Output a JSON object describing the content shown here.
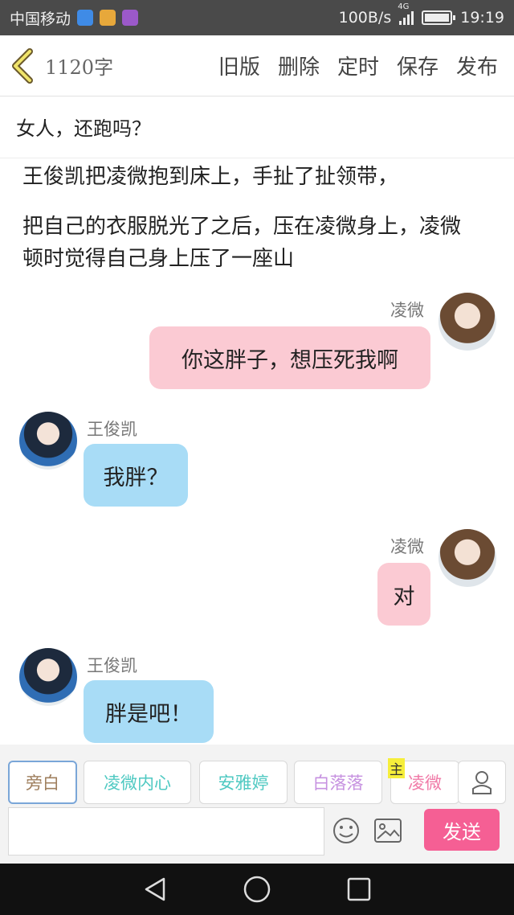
{
  "status_bar": {
    "carrier": "中国移动",
    "speed": "100B/s",
    "network": "4G",
    "time": "19:19"
  },
  "toolbar": {
    "word_count": "1120字",
    "actions": [
      "旧版",
      "删除",
      "定时",
      "保存",
      "发布"
    ]
  },
  "story": {
    "title": "女人，还跑吗？",
    "narration": [
      "王俊凯把凌微抱到床上，手扯了扯领带，",
      "把自己的衣服脱光了之后，压在凌微身上，凌微顿时觉得自己身上压了一座山"
    ]
  },
  "messages": [
    {
      "speaker": "凌微",
      "text": "你这胖子，想压死我啊",
      "side": "right"
    },
    {
      "speaker": "王俊凯",
      "text": "我胖？",
      "side": "left"
    },
    {
      "speaker": "凌微",
      "text": "对",
      "side": "right"
    },
    {
      "speaker": "王俊凯",
      "text": "胖是吧！",
      "side": "left"
    }
  ],
  "roles": [
    {
      "label": "旁白",
      "color": "#9f7f5e"
    },
    {
      "label": "凌微内心",
      "color": "#4fc9c2"
    },
    {
      "label": "安雅婷",
      "color": "#4fc9c2"
    },
    {
      "label": "白落落",
      "color": "#c691e0"
    },
    {
      "label": "凌微",
      "color": "#f07aa7",
      "tag": "主"
    }
  ],
  "composer": {
    "placeholder": "",
    "send_label": "发送"
  },
  "colors": {
    "pink_bubble": "#fbcad3",
    "blue_bubble": "#a8dcf6",
    "send": "#f55f94"
  }
}
